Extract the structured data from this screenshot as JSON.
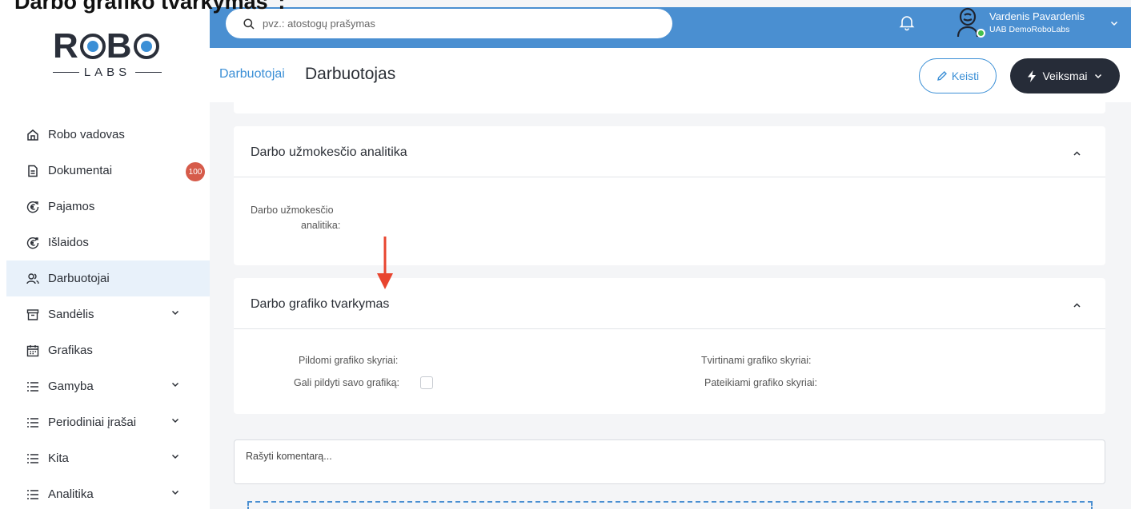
{
  "caption": "Darbo grafiko tvarkymas\":",
  "logo": {
    "top": "ROBO",
    "bottom": "LABS"
  },
  "sidebar": {
    "items": [
      {
        "label": "Robo vadovas",
        "icon": "home-icon"
      },
      {
        "label": "Dokumentai",
        "icon": "document-icon",
        "badge": "100"
      },
      {
        "label": "Pajamos",
        "icon": "euro-in-icon"
      },
      {
        "label": "Išlaidos",
        "icon": "euro-out-icon"
      },
      {
        "label": "Darbuotojai",
        "icon": "users-icon",
        "active": true
      },
      {
        "label": "Sandėlis",
        "icon": "archive-icon",
        "expandable": true
      },
      {
        "label": "Grafikas",
        "icon": "calendar-icon"
      },
      {
        "label": "Gamyba",
        "icon": "list-icon",
        "expandable": true
      },
      {
        "label": "Periodiniai įrašai",
        "icon": "list-icon",
        "expandable": true
      },
      {
        "label": "Kita",
        "icon": "list-icon",
        "expandable": true
      },
      {
        "label": "Analitika",
        "icon": "list-icon",
        "expandable": true
      }
    ]
  },
  "topbar": {
    "search_placeholder": "pvz.: atostogų prašymas",
    "user_name": "Vardenis Pavardenis",
    "user_company": "UAB DemoRoboLabs"
  },
  "header": {
    "breadcrumb": "Darbuotojai",
    "title": "Darbuotojas",
    "edit_label": "Keisti",
    "actions_label": "Veiksmai"
  },
  "sections": {
    "salary": {
      "title": "Darbo užmokesčio analitika",
      "field_line1": "Darbo užmokesčio",
      "field_line2": "analitika:"
    },
    "schedule": {
      "title": "Darbo grafiko tvarkymas",
      "fill_departments": "Pildomi grafiko skyriai:",
      "can_fill_own": "Gali pildyti savo grafiką:",
      "confirm_departments": "Tvirtinami grafiko skyriai:",
      "submit_departments": "Pateikiami grafiko skyriai:"
    }
  },
  "comment": {
    "placeholder": "Rašyti komentarą..."
  },
  "colors": {
    "topbar": "#4a8fd1",
    "accent": "#3b8fd6",
    "badge": "#d65b4a",
    "dark_button": "#262c38",
    "arrow": "#e8452f"
  }
}
